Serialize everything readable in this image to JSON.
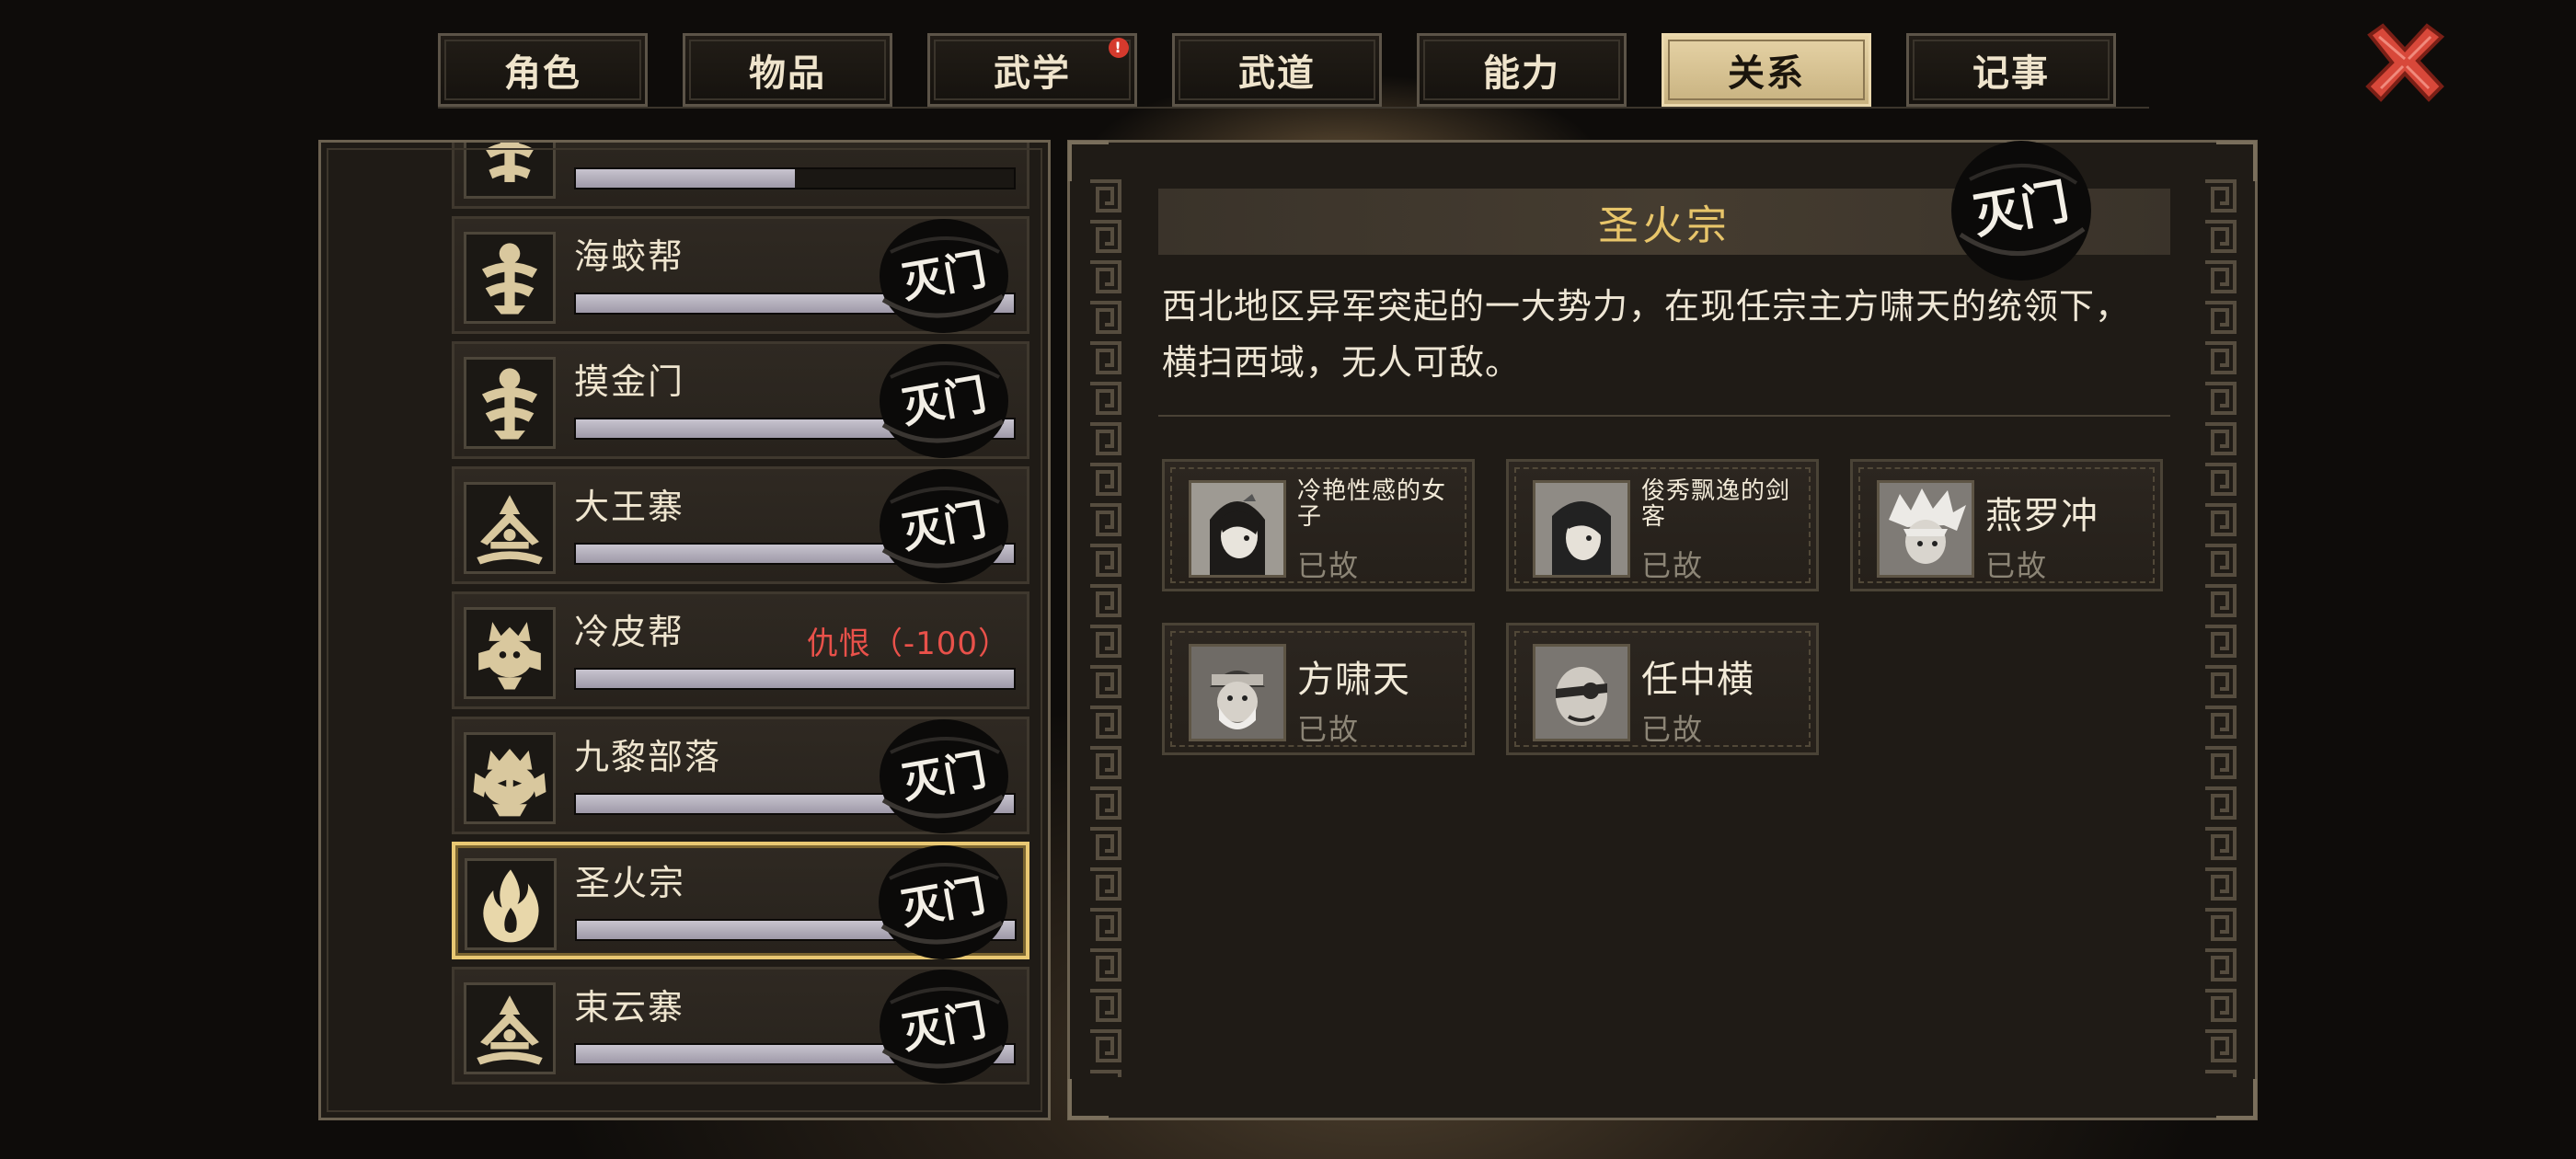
{
  "tabs": [
    {
      "label": "角色"
    },
    {
      "label": "物品"
    },
    {
      "label": "武学",
      "badge": "!"
    },
    {
      "label": "武道"
    },
    {
      "label": "能力"
    },
    {
      "label": "关系",
      "active": true
    },
    {
      "label": "记事"
    }
  ],
  "close_icon": "close-x-icon",
  "factions": [
    {
      "name": "",
      "icon": "clan-emblem-icon",
      "bar": 0.5
    },
    {
      "name": "海蛟帮",
      "icon": "clan-emblem-icon",
      "bar": 1.0,
      "stamp": "灭门"
    },
    {
      "name": "摸金门",
      "icon": "clan-emblem-icon",
      "bar": 1.0,
      "stamp": "灭门"
    },
    {
      "name": "大王寨",
      "icon": "fortress-emblem-icon",
      "bar": 1.0,
      "stamp": "灭门"
    },
    {
      "name": "冷皮帮",
      "icon": "beast-emblem-icon",
      "bar": 1.0,
      "relation": "仇恨（-100）"
    },
    {
      "name": "九黎部落",
      "icon": "tribe-emblem-icon",
      "bar": 1.0,
      "stamp": "灭门"
    },
    {
      "name": "圣火宗",
      "icon": "flame-emblem-icon",
      "bar": 1.0,
      "stamp": "灭门",
      "selected": true
    },
    {
      "name": "束云寨",
      "icon": "fortress-emblem-icon",
      "bar": 1.0,
      "stamp": "灭门"
    }
  ],
  "detail": {
    "title": "圣火宗",
    "stamp": "灭门",
    "description_lines": [
      "西北地区异军突起的一大势力，在现任宗主方啸天的统领下，",
      "横扫西域，无人可敌。"
    ],
    "members": [
      {
        "name": "冷艳性感的女子",
        "status": "已故",
        "small": true
      },
      {
        "name": "俊秀飘逸的剑客",
        "status": "已故",
        "small": true
      },
      {
        "name": "燕罗冲",
        "status": "已故"
      },
      {
        "name": "方啸天",
        "status": "已故"
      },
      {
        "name": "任中横",
        "status": "已故"
      }
    ]
  },
  "colors": {
    "accent_gold": "#e8c56a",
    "hatred_red": "#e9514a",
    "selected_border": "#e9c873"
  }
}
